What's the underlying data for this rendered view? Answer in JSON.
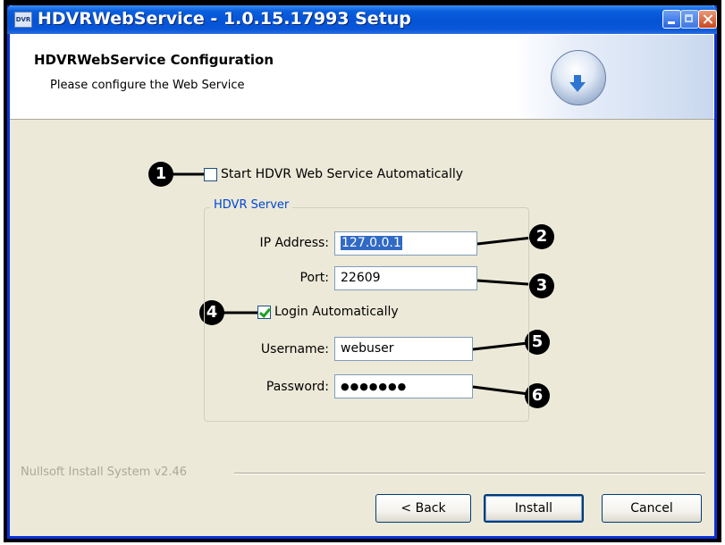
{
  "window": {
    "title": "HDVRWebService - 1.0.15.17993 Setup",
    "icon_text": "DVR"
  },
  "header": {
    "title": "HDVRWebService Configuration",
    "subtitle": "Please configure the Web Service"
  },
  "options": {
    "start_auto_label": "Start HDVR Web Service Automatically",
    "start_auto_checked": false,
    "login_auto_label": "Login Automatically",
    "login_auto_checked": true
  },
  "server": {
    "group_label": "HDVR Server",
    "ip_label": "IP Address:",
    "ip_value": "127.0.0.1",
    "port_label": "Port:",
    "port_value": "22609",
    "username_label": "Username:",
    "username_value": "webuser",
    "password_label": "Password:",
    "password_value": "●●●●●●●"
  },
  "callouts": [
    "1",
    "2",
    "3",
    "4",
    "5",
    "6"
  ],
  "footer": {
    "branding": "Nullsoft Install System v2.46",
    "back_label": "< Back",
    "install_label": "Install",
    "cancel_label": "Cancel"
  },
  "colors": {
    "titlebar": "#0553d6",
    "window_bg": "#ece9d8",
    "group_label": "#0046d5",
    "selection": "#316ac5",
    "callout": "#000000"
  },
  "icons": [
    "installer-disc-icon",
    "minimize-icon",
    "maximize-icon",
    "close-icon",
    "checkbox-icon"
  ]
}
